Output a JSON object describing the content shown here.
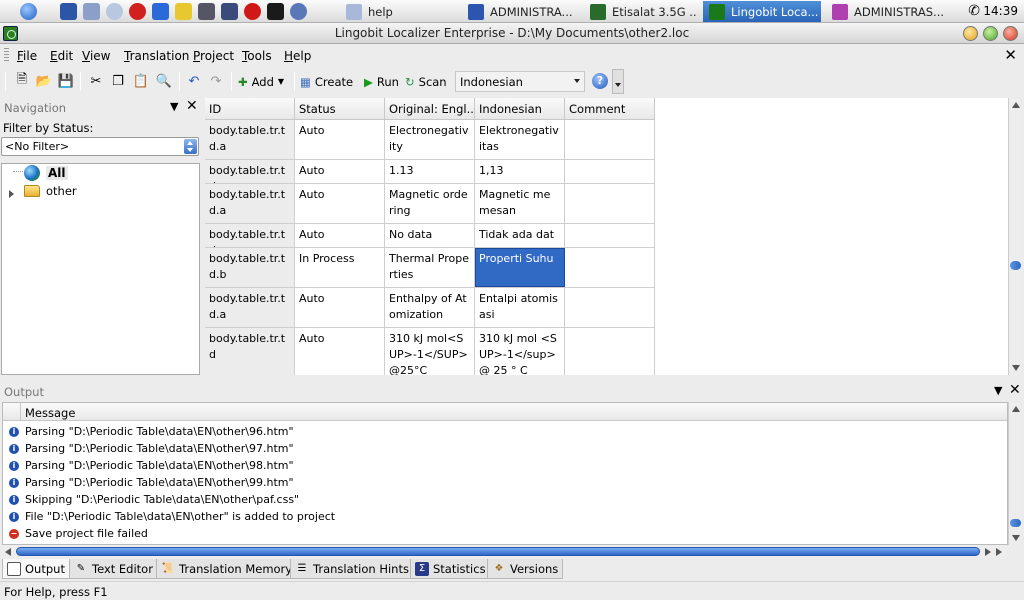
{
  "taskbar": {
    "tasks": [
      {
        "label": "help",
        "icon": "folder-icon"
      },
      {
        "label": "ADMINISTRA...",
        "icon": "word-document-icon"
      },
      {
        "label": "Etisalat 3.5G ...",
        "icon": "etisalat-icon"
      },
      {
        "label": "Lingobit Loca...",
        "icon": "lingobit-icon",
        "active": true
      },
      {
        "label": "ADMINISTRAS...",
        "icon": "paint-icon"
      }
    ],
    "clock": "14:39"
  },
  "window": {
    "title": "Lingobit Localizer Enterprise - D:\\My Documents\\other2.loc"
  },
  "menu": {
    "items": [
      "File",
      "Edit",
      "View",
      "Translation",
      "Project",
      "Tools",
      "Help"
    ]
  },
  "toolbar": {
    "add_label": "Add",
    "create_label": "Create",
    "run_label": "Run",
    "scan_label": "Scan",
    "language_value": "Indonesian"
  },
  "navigation": {
    "title": "Navigation",
    "filter_label": "Filter by Status:",
    "filter_value": "<No Filter>",
    "tree": [
      {
        "label": "All",
        "icon": "globe-icon"
      },
      {
        "label": "other",
        "icon": "folder-icon"
      }
    ]
  },
  "grid": {
    "columns": [
      "ID",
      "Status",
      "Original: Engl...",
      "Indonesian",
      "Comment"
    ],
    "rows": [
      {
        "id": "body.table.tr.td.a",
        "status": "Auto",
        "original": "Electronegativity",
        "translation": "Elektronegativitas",
        "comment": ""
      },
      {
        "id": "body.table.tr.td",
        "status": "Auto",
        "original": "1.13",
        "translation": "1,13",
        "comment": ""
      },
      {
        "id": "body.table.tr.td.a",
        "status": "Auto",
        "original": "Magnetic ordering",
        "translation": "Magnetic memesan",
        "comment": ""
      },
      {
        "id": "body.table.tr.td",
        "status": "Auto",
        "original": "No data",
        "translation": "Tidak ada data",
        "comment": ""
      },
      {
        "id": "body.table.tr.td.b",
        "status": "In Process",
        "original": "Thermal Properties",
        "translation": "Properti Suhu",
        "comment": ""
      },
      {
        "id": "body.table.tr.td.a",
        "status": "Auto",
        "original": "Enthalpy of Atomization",
        "translation": "Entalpi atomisasi",
        "comment": ""
      },
      {
        "id": "body.table.tr.td",
        "status": "Auto",
        "original": "310 kJ mol<SUP>-1</SUP> @25°C",
        "translation": "310 kJ mol <SUP>-1</sup> @ 25 ° C",
        "comment": ""
      }
    ]
  },
  "output": {
    "title": "Output",
    "column": "Message",
    "messages": [
      {
        "type": "info",
        "text": "Parsing \"D:\\Periodic Table\\data\\EN\\other\\96.htm\""
      },
      {
        "type": "info",
        "text": "Parsing \"D:\\Periodic Table\\data\\EN\\other\\97.htm\""
      },
      {
        "type": "info",
        "text": "Parsing \"D:\\Periodic Table\\data\\EN\\other\\98.htm\""
      },
      {
        "type": "info",
        "text": "Parsing \"D:\\Periodic Table\\data\\EN\\other\\99.htm\""
      },
      {
        "type": "info",
        "text": "Skipping \"D:\\Periodic Table\\data\\EN\\other\\paf.css\""
      },
      {
        "type": "info",
        "text": "File \"D:\\Periodic Table\\data\\EN\\other\" is added to project"
      },
      {
        "type": "error",
        "text": "Save project file failed"
      }
    ]
  },
  "tabs": [
    {
      "label": "Output",
      "active": true
    },
    {
      "label": "Text Editor"
    },
    {
      "label": "Translation Memory"
    },
    {
      "label": "Translation Hints"
    },
    {
      "label": "Statistics"
    },
    {
      "label": "Versions"
    }
  ],
  "status": {
    "text": "For Help, press F1"
  },
  "colors": {
    "selection": "#316ac5",
    "scroll_thumb": "#2d67c4"
  }
}
